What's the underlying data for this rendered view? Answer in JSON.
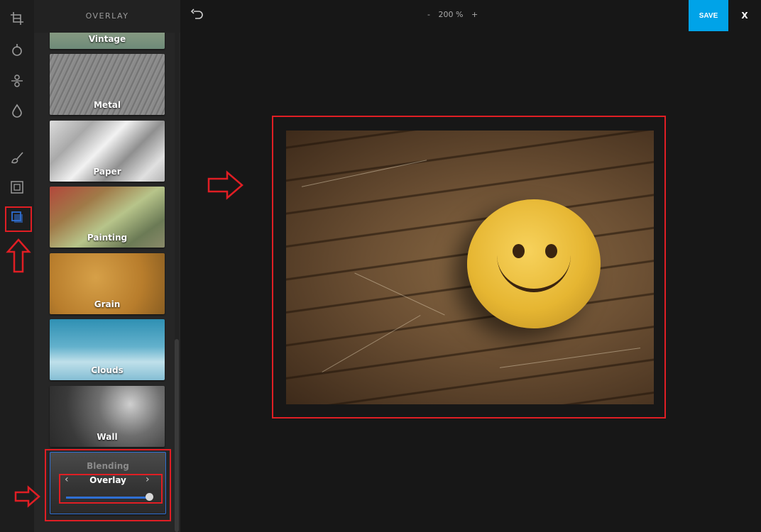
{
  "panel": {
    "title": "OVERLAY",
    "tiles": [
      {
        "label": "Vintage"
      },
      {
        "label": "Metal"
      },
      {
        "label": "Paper"
      },
      {
        "label": "Painting"
      },
      {
        "label": "Grain"
      },
      {
        "label": "Clouds"
      },
      {
        "label": "Wall"
      }
    ],
    "blending": {
      "title": "Blending",
      "mode": "Overlay",
      "prev": "‹",
      "next": "›",
      "level": 1.0
    }
  },
  "topbar": {
    "zoom_minus": "-",
    "zoom_value": "200 %",
    "zoom_plus": "+",
    "save_label": "SAVE",
    "close_label": "X"
  },
  "colors": {
    "accent": "#00a3e8",
    "highlight": "#e01e24",
    "selection": "#2f6fd3"
  }
}
